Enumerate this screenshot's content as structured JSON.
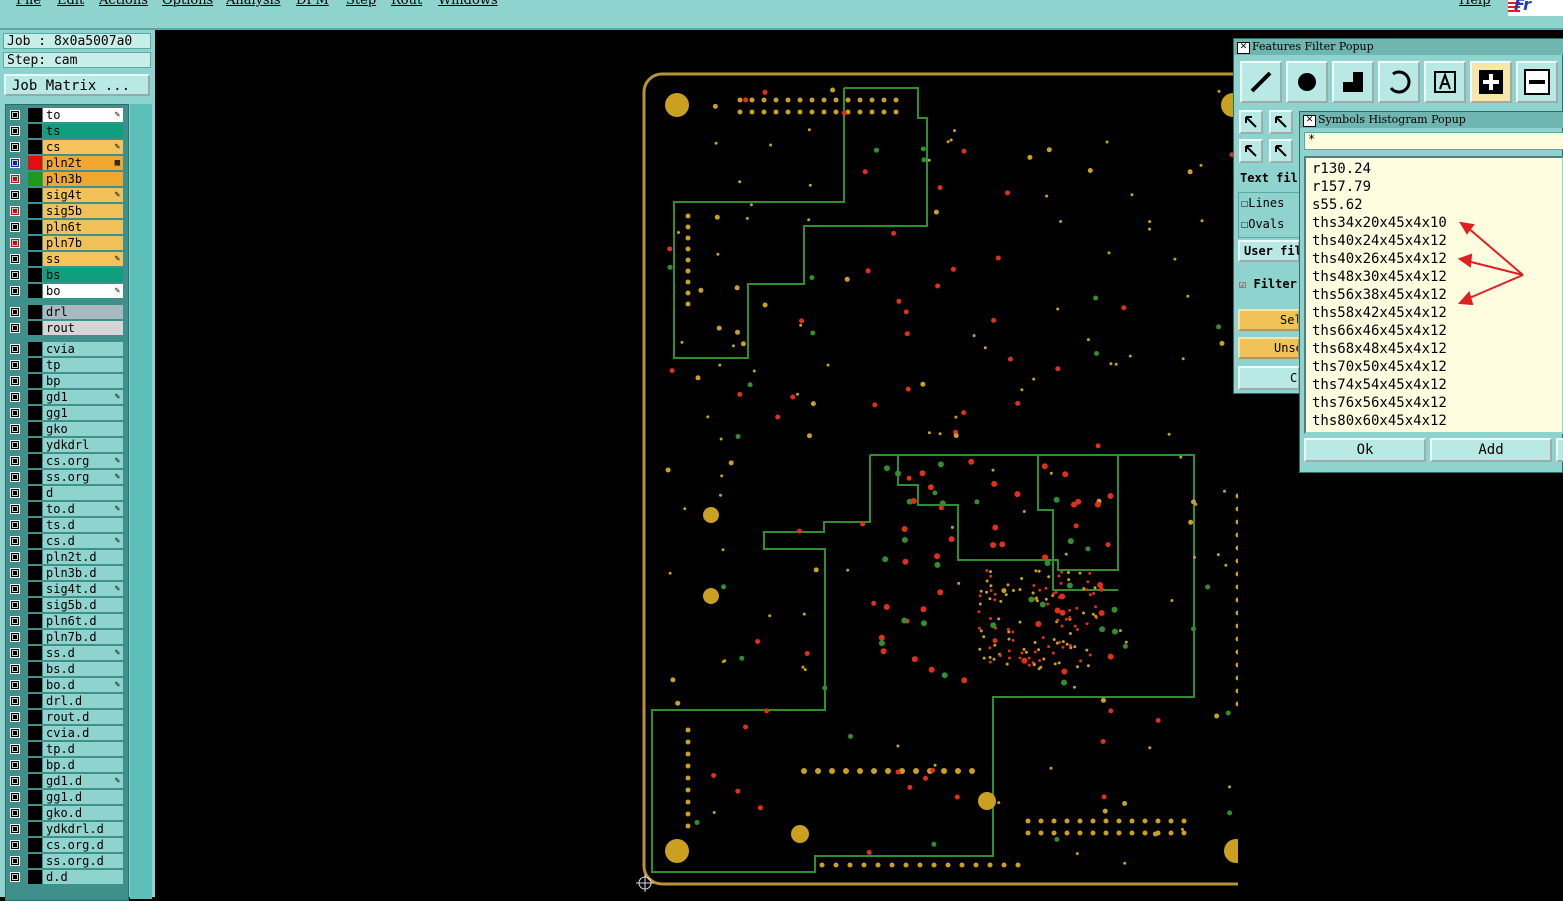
{
  "menu": {
    "items": [
      "File",
      "Edit",
      "Actions",
      "Options",
      "Analysis",
      "DFM",
      "Step",
      "Rout",
      "Windows"
    ],
    "help": "Help",
    "logo_text": "Fr"
  },
  "sidebar": {
    "job_line": "Job : 8x0a5007a0",
    "step_line": "Step: cam",
    "job_matrix_label": "Job Matrix ...",
    "layers": [
      {
        "name": "to",
        "bg": "#ffffff",
        "mark": "✎",
        "sw": "#000000",
        "cb": ""
      },
      {
        "name": "ts",
        "bg": "#0f9f7f",
        "mark": "",
        "sw": "#000000",
        "cb": ""
      },
      {
        "name": "cs",
        "bg": "#f6c35a",
        "mark": "✎",
        "sw": "#000000",
        "cb": ""
      },
      {
        "name": "pln2t",
        "bg": "#f0a830",
        "mark": "▦",
        "sw": "#e01010",
        "cb": "#1020c0"
      },
      {
        "name": "pln3b",
        "bg": "#f0a830",
        "mark": "",
        "sw": "#1c9a1c",
        "cb": "#c01010"
      },
      {
        "name": "sig4t",
        "bg": "#f0c257",
        "mark": "✎",
        "sw": "#000000",
        "cb": ""
      },
      {
        "name": "sig5b",
        "bg": "#f0c257",
        "mark": "",
        "sw": "#000000",
        "cb": "#c01010"
      },
      {
        "name": "pln6t",
        "bg": "#f0c257",
        "mark": "",
        "sw": "#000000",
        "cb": ""
      },
      {
        "name": "pln7b",
        "bg": "#f0c257",
        "mark": "",
        "sw": "#000000",
        "cb": "#c01010"
      },
      {
        "name": "ss",
        "bg": "#f6c35a",
        "mark": "✎",
        "sw": "#000000",
        "cb": ""
      },
      {
        "name": "bs",
        "bg": "#0f9f7f",
        "mark": "",
        "sw": "#000000",
        "cb": ""
      },
      {
        "name": "bo",
        "bg": "#ffffff",
        "mark": "✎",
        "sw": "#000000",
        "cb": ""
      },
      {
        "name": "drl",
        "bg": "#a9b9c0",
        "mark": "",
        "sw": "#000000",
        "cb": ""
      },
      {
        "name": "rout",
        "bg": "#d6d6d6",
        "mark": "",
        "sw": "#000000",
        "cb": ""
      },
      {
        "name": "cvia",
        "bg": "#8fd3cf",
        "mark": "",
        "sw": "#000000",
        "cb": ""
      },
      {
        "name": "tp",
        "bg": "#8fd3cf",
        "mark": "",
        "sw": "#000000",
        "cb": ""
      },
      {
        "name": "bp",
        "bg": "#8fd3cf",
        "mark": "",
        "sw": "#000000",
        "cb": ""
      },
      {
        "name": "gd1",
        "bg": "#8fd3cf",
        "mark": "✎",
        "sw": "#000000",
        "cb": ""
      },
      {
        "name": "gg1",
        "bg": "#8fd3cf",
        "mark": "",
        "sw": "#000000",
        "cb": ""
      },
      {
        "name": "gko",
        "bg": "#8fd3cf",
        "mark": "",
        "sw": "#000000",
        "cb": ""
      },
      {
        "name": "ydkdrl",
        "bg": "#8fd3cf",
        "mark": "",
        "sw": "#000000",
        "cb": ""
      },
      {
        "name": "cs.org",
        "bg": "#8fd3cf",
        "mark": "✎",
        "sw": "#000000",
        "cb": ""
      },
      {
        "name": "ss.org",
        "bg": "#8fd3cf",
        "mark": "✎",
        "sw": "#000000",
        "cb": ""
      },
      {
        "name": "d",
        "bg": "#8fd3cf",
        "mark": "",
        "sw": "#000000",
        "cb": ""
      },
      {
        "name": "to.d",
        "bg": "#8fd3cf",
        "mark": "✎",
        "sw": "#000000",
        "cb": ""
      },
      {
        "name": "ts.d",
        "bg": "#8fd3cf",
        "mark": "",
        "sw": "#000000",
        "cb": ""
      },
      {
        "name": "cs.d",
        "bg": "#8fd3cf",
        "mark": "✎",
        "sw": "#000000",
        "cb": ""
      },
      {
        "name": "pln2t.d",
        "bg": "#8fd3cf",
        "mark": "",
        "sw": "#000000",
        "cb": ""
      },
      {
        "name": "pln3b.d",
        "bg": "#8fd3cf",
        "mark": "",
        "sw": "#000000",
        "cb": ""
      },
      {
        "name": "sig4t.d",
        "bg": "#8fd3cf",
        "mark": "✎",
        "sw": "#000000",
        "cb": ""
      },
      {
        "name": "sig5b.d",
        "bg": "#8fd3cf",
        "mark": "",
        "sw": "#000000",
        "cb": ""
      },
      {
        "name": "pln6t.d",
        "bg": "#8fd3cf",
        "mark": "",
        "sw": "#000000",
        "cb": ""
      },
      {
        "name": "pln7b.d",
        "bg": "#8fd3cf",
        "mark": "",
        "sw": "#000000",
        "cb": ""
      },
      {
        "name": "ss.d",
        "bg": "#8fd3cf",
        "mark": "✎",
        "sw": "#000000",
        "cb": ""
      },
      {
        "name": "bs.d",
        "bg": "#8fd3cf",
        "mark": "",
        "sw": "#000000",
        "cb": ""
      },
      {
        "name": "bo.d",
        "bg": "#8fd3cf",
        "mark": "✎",
        "sw": "#000000",
        "cb": ""
      },
      {
        "name": "drl.d",
        "bg": "#8fd3cf",
        "mark": "",
        "sw": "#000000",
        "cb": ""
      },
      {
        "name": "rout.d",
        "bg": "#8fd3cf",
        "mark": "",
        "sw": "#000000",
        "cb": ""
      },
      {
        "name": "cvia.d",
        "bg": "#8fd3cf",
        "mark": "",
        "sw": "#000000",
        "cb": ""
      },
      {
        "name": "tp.d",
        "bg": "#8fd3cf",
        "mark": "",
        "sw": "#000000",
        "cb": ""
      },
      {
        "name": "bp.d",
        "bg": "#8fd3cf",
        "mark": "",
        "sw": "#000000",
        "cb": ""
      },
      {
        "name": "gd1.d",
        "bg": "#8fd3cf",
        "mark": "✎",
        "sw": "#000000",
        "cb": ""
      },
      {
        "name": "gg1.d",
        "bg": "#8fd3cf",
        "mark": "",
        "sw": "#000000",
        "cb": ""
      },
      {
        "name": "gko.d",
        "bg": "#8fd3cf",
        "mark": "",
        "sw": "#000000",
        "cb": ""
      },
      {
        "name": "ydkdrl.d",
        "bg": "#8fd3cf",
        "mark": "",
        "sw": "#000000",
        "cb": ""
      },
      {
        "name": "cs.org.d",
        "bg": "#8fd3cf",
        "mark": "",
        "sw": "#000000",
        "cb": ""
      },
      {
        "name": "ss.org.d",
        "bg": "#8fd3cf",
        "mark": "",
        "sw": "#000000",
        "cb": ""
      },
      {
        "name": "d.d",
        "bg": "#8fd3cf",
        "mark": "",
        "sw": "#000000",
        "cb": ""
      }
    ]
  },
  "features_filter": {
    "title": "Features Filter Popup",
    "text_filter_label": "Text fil",
    "lines_label": "Lines",
    "ovals_label": "Ovals",
    "user_filter_label": "User fil",
    "filter_label": "Filter",
    "select_label": "Sel",
    "unselect_label": "Unse",
    "close_label": "C"
  },
  "symbols_histogram": {
    "title": "Symbols Histogram Popup",
    "filter_value": "*",
    "items": [
      "r130.24",
      "r157.79",
      "s55.62",
      "ths34x20x45x4x10",
      "ths40x24x45x4x12",
      "ths40x26x45x4x12",
      "ths48x30x45x4x12",
      "ths56x38x45x4x12",
      "ths58x42x45x4x12",
      "ths66x46x45x4x12",
      "ths68x48x45x4x12",
      "ths70x50x45x4x12",
      "ths74x54x45x4x12",
      "ths76x56x45x4x12",
      "ths80x60x45x4x12"
    ],
    "ok_label": "Ok",
    "add_label": "Add"
  },
  "colors": {
    "outline": "#b8933a",
    "trace": "#2f8f2f",
    "pad": "#c9a020",
    "via_red": "#e03018",
    "annotation_arrow": "#e02020"
  }
}
